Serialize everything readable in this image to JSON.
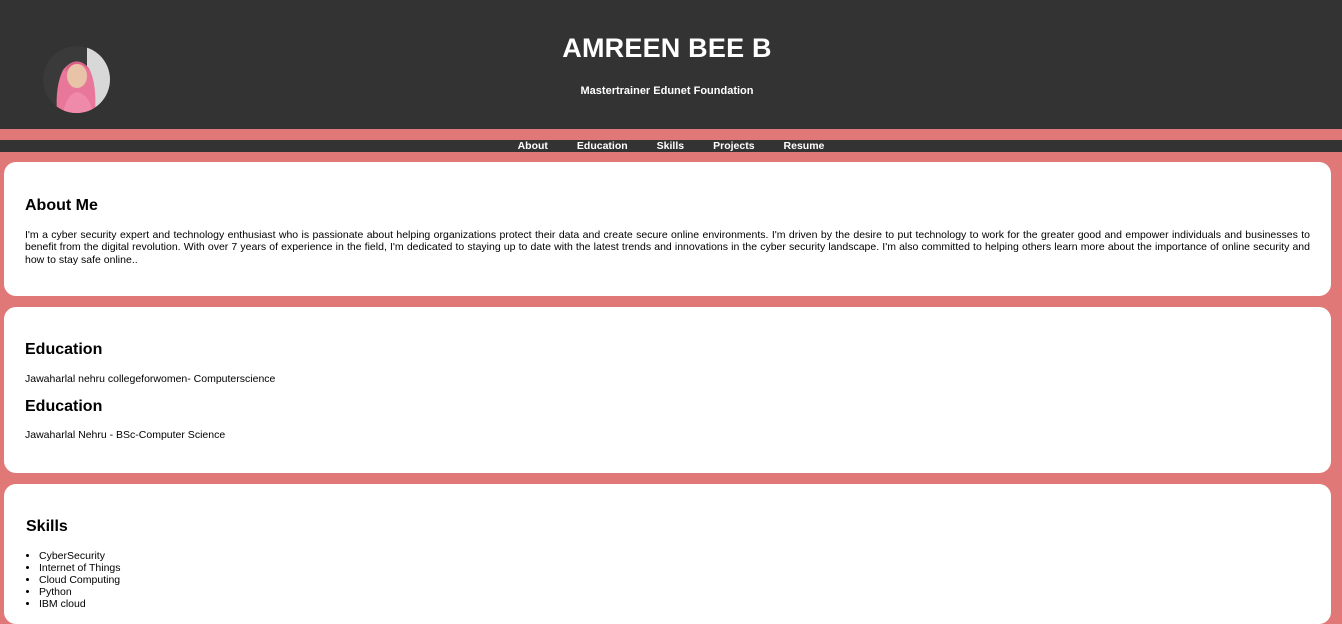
{
  "header": {
    "name": "AMREEN BEE B",
    "subtitle": "Mastertrainer Edunet Foundation"
  },
  "nav": {
    "items": [
      "About",
      "Education",
      "Skills",
      "Projects",
      "Resume"
    ]
  },
  "about": {
    "heading": "About Me",
    "text": "I'm a cyber security expert and technology enthusiast who is passionate about helping organizations protect their data and create secure online environments. I'm driven by the desire to put technology to work for the greater good and empower individuals and businesses to benefit from the digital revolution. With over 7 years of experience in the field, I'm dedicated to staying up to date with the latest trends and innovations in the cyber security landscape. I'm also committed to helping others learn more about the importance of online security and how to stay safe online.."
  },
  "education": {
    "entries": [
      {
        "heading": "Education",
        "text": "Jawaharlal nehru collegeforwomen- Computerscience"
      },
      {
        "heading": "Education",
        "text": "Jawaharlal Nehru - BSc-Computer Science"
      }
    ]
  },
  "skills": {
    "heading": "Skills",
    "items": [
      "CyberSecurity",
      "Internet of Things",
      "Cloud Computing",
      "Python",
      "IBM cloud"
    ]
  },
  "colors": {
    "background": "#e07878",
    "header": "#333333",
    "card": "#ffffff"
  }
}
